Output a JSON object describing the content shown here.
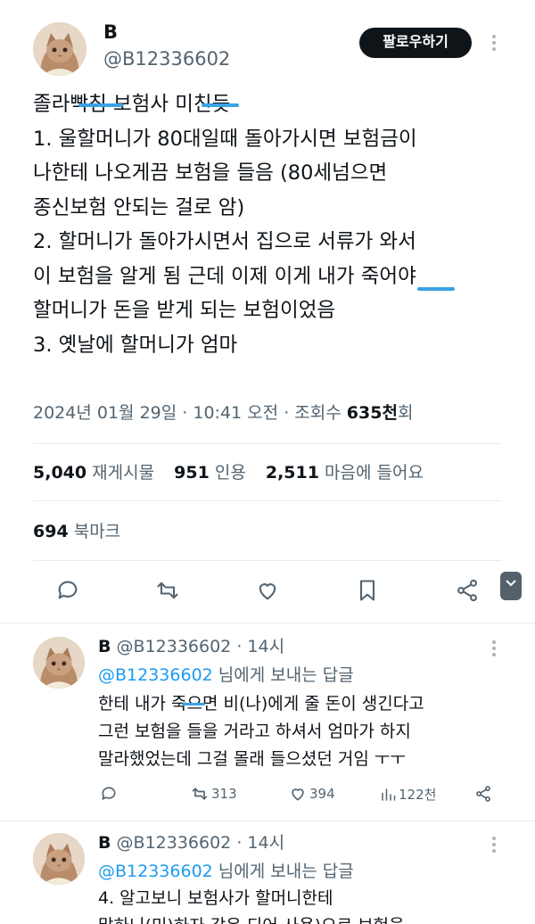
{
  "tweet": {
    "display_name": "B",
    "handle": "@B12336602",
    "follow_label": "팔로우하기",
    "lines": [
      "졸라빡침 보험사 미친듯",
      "1. 울할머니가 80대일때 돌아가시면 보험금이",
      "나한테 나오게끔 보험을 들음 (80세넘으면",
      "종신보험 안되는 걸로 암)",
      "2. 할머니가 돌아가시면서 집으로 서류가 와서",
      "이 보험을 알게 됨 근데 이제 이게 내가 죽어야",
      "할머니가 돈을 받게 되는 보험이었음",
      "3. 옛날에 할머니가 엄마"
    ],
    "date": "2024년 01월 29일",
    "time": "10:41 오전",
    "views_label": "조회수",
    "views_number": "635천",
    "views_suffix": "회",
    "retweets": "5,040",
    "retweets_label": "재게시물",
    "quotes": "951",
    "quotes_label": "인용",
    "likes": "2,511",
    "likes_label": "마음에 들어요",
    "bookmarks": "694",
    "bookmarks_label": "북마크"
  },
  "action_icons": [
    "reply-icon",
    "retweet-icon",
    "like-icon",
    "bookmark-icon",
    "share-icon"
  ],
  "replies": [
    {
      "name": "B",
      "handle": "@B12336602",
      "time": "14시",
      "to_mention": "@B12336602",
      "to_suffix": "님에게 보내는 답글",
      "lines": [
        "한테 내가 죽으면 비(나)에게 줄 돈이 생긴다고",
        "그런 보험을 들을 거라고 하셔서 엄마가 하지",
        "말라했었는데 그걸 몰래 들으셨던 거임 ㅜㅜ"
      ],
      "retweets": "313",
      "likes": "394",
      "views": "122천"
    },
    {
      "name": "B",
      "handle": "@B12336602",
      "time": "14시",
      "to_mention": "@B12336602",
      "to_suffix": "님에게 보내는 답글",
      "lines": [
        "4. 알고보니 보험사가 할머니한테",
        "말하니(미)하자 같은 되어 사용)으로 보험을"
      ]
    }
  ],
  "colors": {
    "accent": "#1d9bf0",
    "text": "#0f1419",
    "muted": "#536471",
    "button": "#0f1419"
  }
}
